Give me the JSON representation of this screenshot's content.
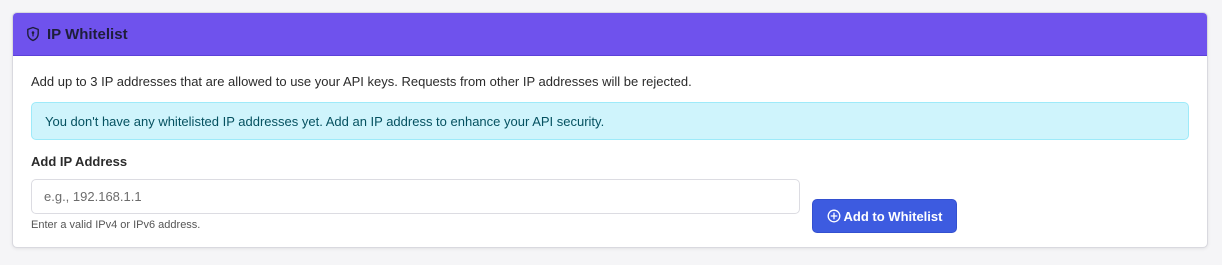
{
  "header": {
    "title": "IP Whitelist",
    "icon": "shield-icon",
    "color": "#6f52ed"
  },
  "description": "Add up to 3 IP addresses that are allowed to use your API keys. Requests from other IP addresses will be rejected.",
  "alert": {
    "text": "You don't have any whitelisted IP addresses yet. Add an IP address to enhance your API security.",
    "background": "#cff4fc"
  },
  "form": {
    "label": "Add IP Address",
    "input_value": "",
    "placeholder": "e.g., 192.168.1.1",
    "help_text": "Enter a valid IPv4 or IPv6 address.",
    "button_label": "Add to Whitelist",
    "button_icon": "plus-circle-icon",
    "button_color": "#3d5be0"
  }
}
